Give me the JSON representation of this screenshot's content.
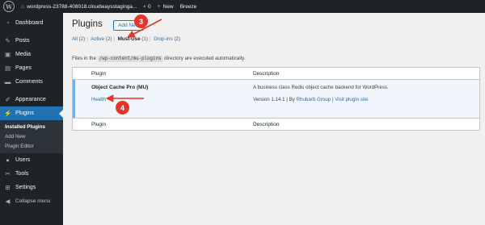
{
  "adminbar": {
    "site": "wordpress-23788-408018.cloudwaysstaginga...",
    "comments": "0",
    "new_label": "New",
    "breeze": "Breeze"
  },
  "sidebar": {
    "items": [
      {
        "label": "Dashboard",
        "icon": "dashboard-icon"
      },
      {
        "label": "Posts",
        "icon": "pin-icon"
      },
      {
        "label": "Media",
        "icon": "media-icon"
      },
      {
        "label": "Pages",
        "icon": "pages-icon"
      },
      {
        "label": "Comments",
        "icon": "comments-icon"
      },
      {
        "label": "Appearance",
        "icon": "brush-icon"
      },
      {
        "label": "Plugins",
        "icon": "plugin-icon"
      },
      {
        "label": "Users",
        "icon": "users-icon"
      },
      {
        "label": "Tools",
        "icon": "wrench-icon"
      },
      {
        "label": "Settings",
        "icon": "settings-icon"
      },
      {
        "label": "Collapse menu",
        "icon": "collapse-icon"
      }
    ],
    "submenu": [
      "Installed Plugins",
      "Add New",
      "Plugin Editor"
    ]
  },
  "page": {
    "title": "Plugins",
    "add_new": "Add New",
    "filters": {
      "all": "All",
      "all_count": "(2)",
      "active": "Active",
      "active_count": "(2)",
      "mustuse": "Must-Use",
      "mustuse_count": "(1)",
      "dropins": "Drop-ins",
      "dropins_count": "(2)"
    },
    "note_pre": "Files in the",
    "note_code": "/wp-content/mu-plugins",
    "note_post": "directory are executed automatically."
  },
  "table": {
    "col_plugin": "Plugin",
    "col_desc": "Description",
    "row": {
      "name": "Object Cache Pro (MU)",
      "link": "Health",
      "description": "A business class Redis object cache backend for WordPress.",
      "version": "Version 1.14.1",
      "by": "By",
      "author": "Rhubarb Group",
      "site_link": "Visit plugin site"
    }
  },
  "annotations": {
    "step3": "3",
    "step4": "4",
    "color": "#e0362b"
  }
}
